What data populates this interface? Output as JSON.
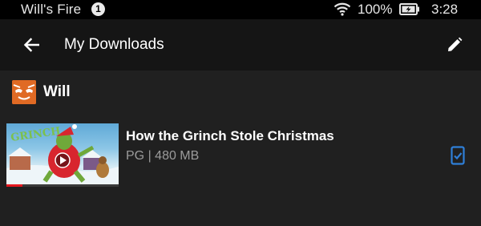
{
  "status_bar": {
    "device_name": "Will's Fire",
    "notification_count": "1",
    "battery_percent": "100%",
    "time": "3:28",
    "icons": [
      "wifi-icon",
      "battery-charging-icon"
    ]
  },
  "app_bar": {
    "title": "My Downloads",
    "icons": [
      "back-arrow-icon",
      "edit-pencil-icon"
    ]
  },
  "profile": {
    "name": "Will",
    "avatar_color": "#e06a24"
  },
  "downloads": [
    {
      "title": "How the Grinch Stole Christmas",
      "meta": "PG | 480 MB",
      "thumbnail_text": "GRINCH",
      "watched_fraction": 0.14,
      "status_icon": "downloaded-device-icon"
    }
  ],
  "colors": {
    "accent": "#2f7fd8",
    "progress": "#e5181f",
    "background": "#202020",
    "app_bar": "#151515"
  }
}
